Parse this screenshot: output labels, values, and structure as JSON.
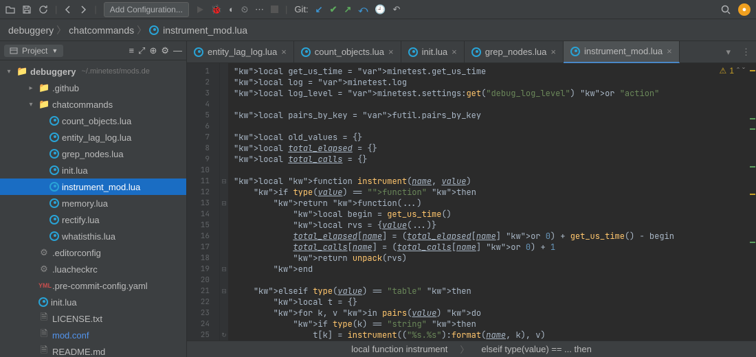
{
  "toolbar": {
    "config_label": "Add Configuration...",
    "git_label": "Git:"
  },
  "breadcrumbs": [
    "debuggery",
    "chatcommands",
    "instrument_mod.lua"
  ],
  "sidebar": {
    "title": "Project",
    "root": {
      "name": "debuggery",
      "path": "~/.minetest/mods.de"
    },
    "items": [
      {
        "type": "dir",
        "name": ".github",
        "expanded": false,
        "depth": 1
      },
      {
        "type": "dir",
        "name": "chatcommands",
        "expanded": true,
        "depth": 1
      },
      {
        "type": "lua",
        "name": "count_objects.lua",
        "depth": 2
      },
      {
        "type": "lua",
        "name": "entity_lag_log.lua",
        "depth": 2
      },
      {
        "type": "lua",
        "name": "grep_nodes.lua",
        "depth": 2
      },
      {
        "type": "lua",
        "name": "init.lua",
        "depth": 2
      },
      {
        "type": "lua",
        "name": "instrument_mod.lua",
        "depth": 2,
        "selected": true
      },
      {
        "type": "lua",
        "name": "memory.lua",
        "depth": 2
      },
      {
        "type": "lua",
        "name": "rectify.lua",
        "depth": 2
      },
      {
        "type": "lua",
        "name": "whatisthis.lua",
        "depth": 2
      },
      {
        "type": "cfg",
        "name": ".editorconfig",
        "depth": 1
      },
      {
        "type": "cfg",
        "name": ".luacheckrc",
        "depth": 1
      },
      {
        "type": "yaml",
        "name": ".pre-commit-config.yaml",
        "depth": 1
      },
      {
        "type": "lua",
        "name": "init.lua",
        "depth": 1
      },
      {
        "type": "txt",
        "name": "LICENSE.txt",
        "depth": 1
      },
      {
        "type": "txt",
        "name": "mod.conf",
        "depth": 1,
        "highlighted": true
      },
      {
        "type": "md",
        "name": "README.md",
        "depth": 1
      }
    ]
  },
  "tabs": [
    {
      "label": "entity_lag_log.lua",
      "active": false
    },
    {
      "label": "count_objects.lua",
      "active": false
    },
    {
      "label": "init.lua",
      "active": false
    },
    {
      "label": "grep_nodes.lua",
      "active": false
    },
    {
      "label": "instrument_mod.lua",
      "active": true
    }
  ],
  "editor": {
    "warning_count": "1",
    "lines": [
      "local get_us_time = minetest.get_us_time",
      "local log = minetest.log",
      "local log_level = minetest.settings:get(\"debug_log_level\") or \"action\"",
      "",
      "local pairs_by_key = futil.pairs_by_key",
      "",
      "local old_values = {}",
      "local total_elapsed = {}",
      "local total_calls = {}",
      "",
      "local function instrument(name, value)",
      "    if type(value) == \"function\" then",
      "        return function(...)",
      "            local begin = get_us_time()",
      "            local rvs = {value(...)}",
      "            total_elapsed[name] = (total_elapsed[name] or 0) + get_us_time() - begin",
      "            total_calls[name] = (total_calls[name] or 0) + 1",
      "            return unpack(rvs)",
      "        end",
      "",
      "    elseif type(value) == \"table\" then",
      "        local t = {}",
      "        for k, v in pairs(value) do",
      "            if type(k) == \"string\" then",
      "                t[k] = instrument((\"%s.%s\"):format(name, k), v)"
    ]
  },
  "bottom_crumbs": [
    "local function instrument",
    "elseif type(value) == ... then"
  ]
}
